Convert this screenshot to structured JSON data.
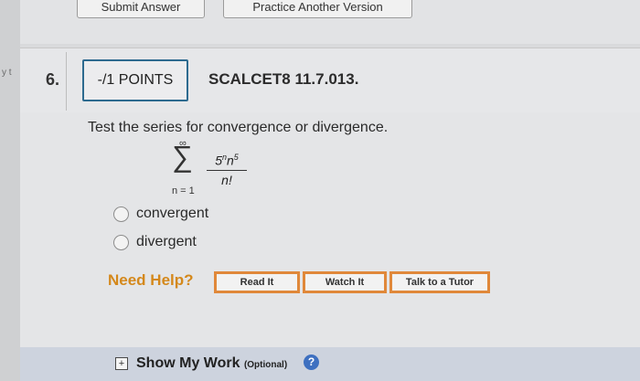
{
  "top": {
    "submit_label": "Submit Answer",
    "practice_label": "Practice Another Version"
  },
  "edge_fragment": "y t",
  "question": {
    "number": "6.",
    "points": "-/1 POINTS",
    "code": "SCALCET8 11.7.013."
  },
  "prompt": "Test the series for convergence or divergence.",
  "series": {
    "upper_limit": "∞",
    "sigma": "∑",
    "lower_limit": "n = 1",
    "numerator_base": "5",
    "numerator_exp1": "n",
    "numerator_var": "n",
    "numerator_exp2": "5",
    "denominator": "n!"
  },
  "options": [
    {
      "label": "convergent"
    },
    {
      "label": "divergent"
    }
  ],
  "help": {
    "title": "Need Help?",
    "read_label": "Read It",
    "watch_label": "Watch It",
    "tutor_label": "Talk to a Tutor"
  },
  "footer": {
    "show_work_label": "Show My Work",
    "optional_label": "(Optional)",
    "plus_glyph": "+",
    "help_glyph": "?"
  },
  "colors": {
    "accent_orange": "#e0883a",
    "points_border": "#2d6a8f",
    "help_icon": "#3e70c0"
  }
}
